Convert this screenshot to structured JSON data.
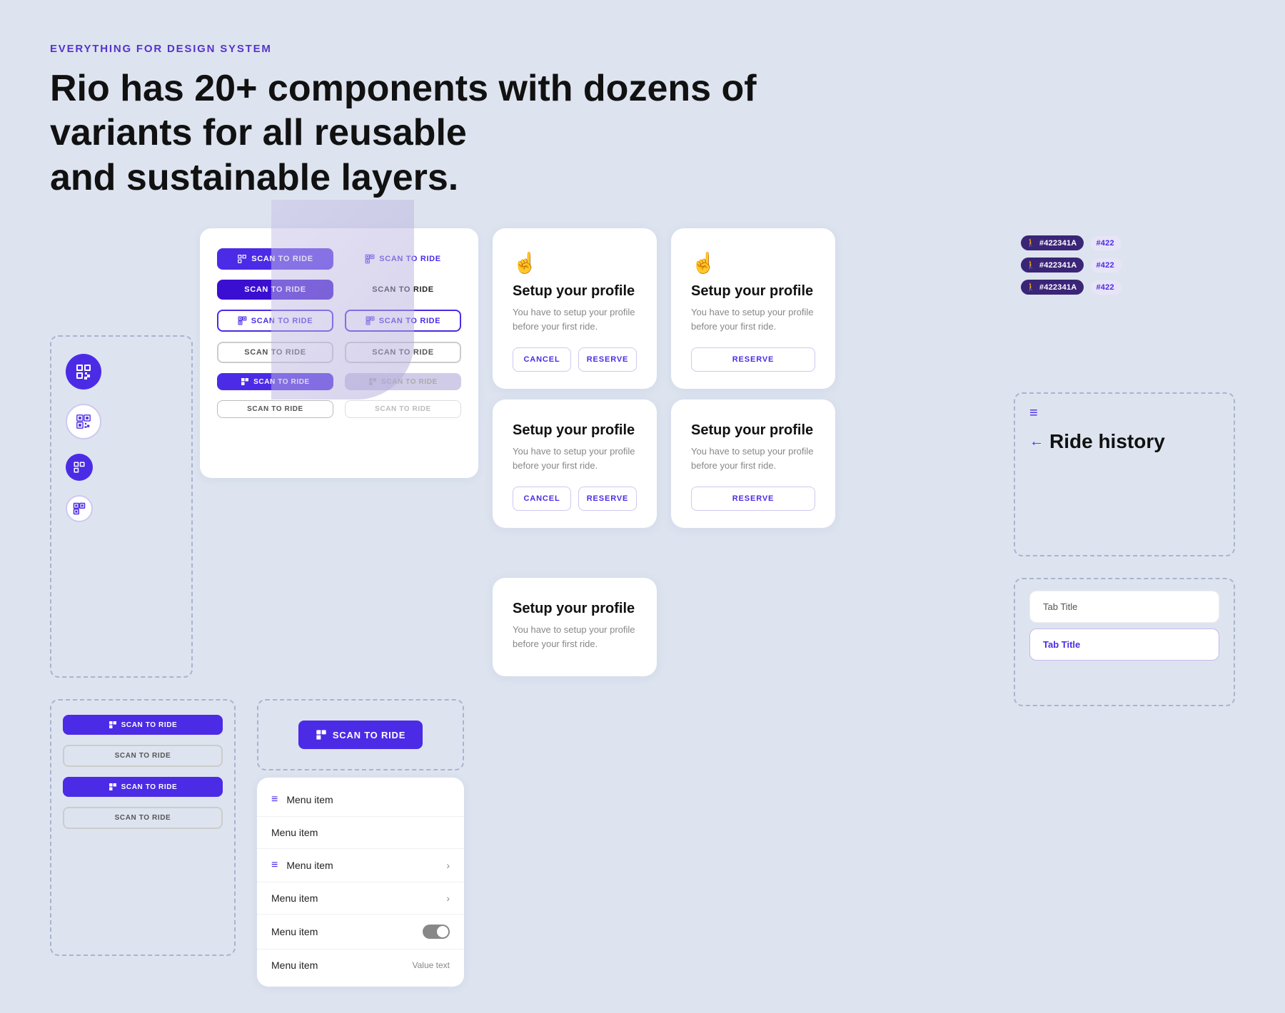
{
  "header": {
    "eyebrow": "EVERYTHING FOR DESIGN SYSTEM",
    "headline_line1": "Rio has 20+ components with dozens of variants for all reusable",
    "headline_line2": "and sustainable layers."
  },
  "button_grid": {
    "buttons": [
      {
        "label": "SCAN TO RIDE",
        "variant": "filled-purple",
        "has_icon": true
      },
      {
        "label": "SCAN TO RIDE",
        "variant": "outline-text-purple",
        "has_icon": true
      },
      {
        "label": "SCAN TO RIDE",
        "variant": "filled-dark-purple",
        "has_icon": false
      },
      {
        "label": "SCAN TO RIDE",
        "variant": "outline-text-plain",
        "has_icon": false
      },
      {
        "label": "SCAN TO RIDE",
        "variant": "outline-purple",
        "has_icon": true
      },
      {
        "label": "SCAN TO RIDE",
        "variant": "outline-purple",
        "has_icon": true
      },
      {
        "label": "SCAN TO RIDE",
        "variant": "outline-plain",
        "has_icon": false
      },
      {
        "label": "SCAN TO RIDE",
        "variant": "outline-plain",
        "has_icon": false
      },
      {
        "label": "SCAN TO RIDE",
        "variant": "filled-purple-sm",
        "has_icon": true
      },
      {
        "label": "SCAN TO RIDE",
        "variant": "filled-gray",
        "has_icon": true
      },
      {
        "label": "SCAN TO RIDE",
        "variant": "outline-plain-sm",
        "has_icon": false
      },
      {
        "label": "SCAN TO RIDE",
        "variant": "outline-gray-sm",
        "has_icon": false
      }
    ]
  },
  "profile_cards": [
    {
      "id": "card1",
      "title": "Setup your profile",
      "description": "You have to setup your profile before your first ride.",
      "has_cancel": true,
      "has_reserve": true
    },
    {
      "id": "card2",
      "title": "Setup your profile",
      "description": "You have to setup your profile before your first ride.",
      "has_cancel": false,
      "has_reserve": true
    },
    {
      "id": "card3",
      "title": "Setup your profile",
      "description": "You have to setup your profile before your first ride.",
      "has_cancel": true,
      "has_reserve": true
    },
    {
      "id": "card4",
      "title": "Setup your profile",
      "description": "You have to setup your profile before your first ride.",
      "has_cancel": false,
      "has_reserve": true
    },
    {
      "id": "card5",
      "title": "Setup your profile",
      "description": "You have to setup your profile before your first ride.",
      "has_cancel": false,
      "has_reserve": false
    }
  ],
  "color_chips": [
    {
      "label": "#422341A",
      "variant": "dark"
    },
    {
      "label": "#422",
      "variant": "light"
    },
    {
      "label": "#422341A",
      "variant": "dark"
    },
    {
      "label": "#422",
      "variant": "light"
    },
    {
      "label": "#422341A",
      "variant": "dark"
    },
    {
      "label": "#422",
      "variant": "light"
    }
  ],
  "menu_items": [
    {
      "label": "Menu item",
      "has_icon": true,
      "has_chevron": false,
      "has_toggle": false,
      "has_value": false
    },
    {
      "label": "Menu item",
      "has_icon": false,
      "has_chevron": false,
      "has_toggle": false,
      "has_value": false
    },
    {
      "label": "Menu item",
      "has_icon": true,
      "has_chevron": true,
      "has_toggle": false,
      "has_value": false
    },
    {
      "label": "Menu item",
      "has_icon": false,
      "has_chevron": true,
      "has_toggle": false,
      "has_value": false
    },
    {
      "label": "Menu item",
      "has_icon": false,
      "has_chevron": false,
      "has_toggle": true,
      "has_value": false
    },
    {
      "label": "Menu item",
      "has_icon": false,
      "has_chevron": false,
      "has_toggle": false,
      "has_value": true,
      "value": "Value text"
    }
  ],
  "scan_list_left": [
    {
      "label": "SCAN TO RIDE",
      "variant": "filled-purple",
      "has_icon": true
    },
    {
      "label": "SCAN TO RIDE",
      "variant": "outline-plain",
      "has_icon": false
    },
    {
      "label": "SCAN TO RIDE",
      "variant": "filled-purple",
      "has_icon": true
    },
    {
      "label": "SCAN TO RIDE",
      "variant": "outline-plain",
      "has_icon": false
    }
  ],
  "ride_history": {
    "back_label": "←",
    "title": "Ride history"
  },
  "tabs": [
    {
      "label": "Tab Title",
      "active": false
    },
    {
      "label": "Tab Title",
      "active": true
    }
  ],
  "icon_buttons": [
    {
      "type": "solid",
      "icon": "⊞"
    },
    {
      "type": "outline",
      "icon": "⊞"
    },
    {
      "type": "solid-sm",
      "icon": "⊞"
    },
    {
      "type": "outline-sm",
      "icon": "⊞"
    }
  ],
  "cancel_label": "CANCEL",
  "reserve_label": "RESERVE",
  "menu_icon": "≡",
  "menu_back_icon": "←"
}
